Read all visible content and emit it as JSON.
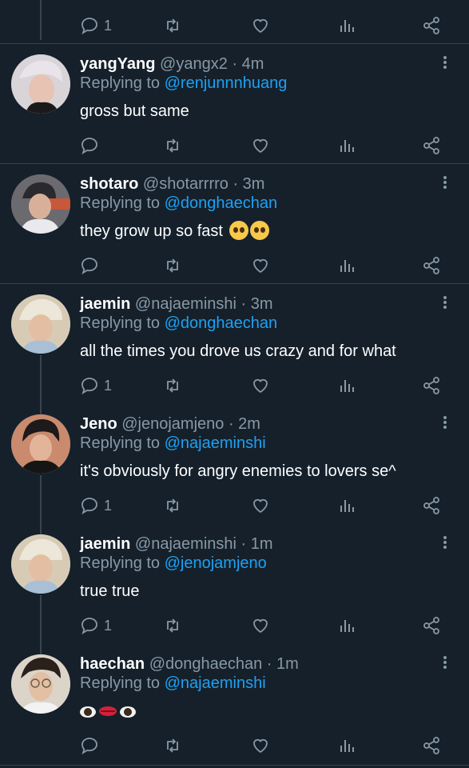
{
  "top_actions": {
    "reply_count": "1"
  },
  "tweets": [
    {
      "name": "yangYang",
      "handle": "@yangx2 · 4m",
      "reply_prefix": "Replying to ",
      "reply_to": "@renjunnnhuang",
      "text": "gross but same",
      "reply_count": ""
    },
    {
      "name": "shotaro",
      "handle": "@shotarrrro · 3m",
      "reply_prefix": "Replying to ",
      "reply_to": "@donghaechan",
      "text": "they grow up so fast",
      "reply_count": ""
    },
    {
      "name": "jaemin",
      "handle": "@najaeminshi · 3m",
      "reply_prefix": "Replying to ",
      "reply_to": "@donghaechan",
      "text": "all the times you drove us crazy and for what",
      "reply_count": "1"
    },
    {
      "name": "Jeno",
      "handle": "@jenojamjeno · 2m",
      "reply_prefix": "Replying to ",
      "reply_to": "@najaeminshi",
      "text": "it's obviously for angry enemies to lovers se^",
      "reply_count": "1"
    },
    {
      "name": "jaemin",
      "handle": "@najaeminshi · 1m",
      "reply_prefix": "Replying to ",
      "reply_to": "@jenojamjeno",
      "text": "true true",
      "reply_count": "1"
    },
    {
      "name": "haechan",
      "handle": "@donghaechan · 1m",
      "reply_prefix": "Replying to ",
      "reply_to": "@najaeminshi",
      "text": "",
      "reply_count": ""
    }
  ],
  "colors": {
    "background": "#15202b",
    "muted": "#8899a6",
    "accent": "#1da1f2",
    "divider": "#38444d"
  },
  "icons": {
    "reply": "speech-bubble-icon",
    "retweet": "retweet-icon",
    "like": "heart-icon",
    "stats": "bar-chart-icon",
    "share": "share-icon",
    "menu": "vertical-dots-icon"
  }
}
